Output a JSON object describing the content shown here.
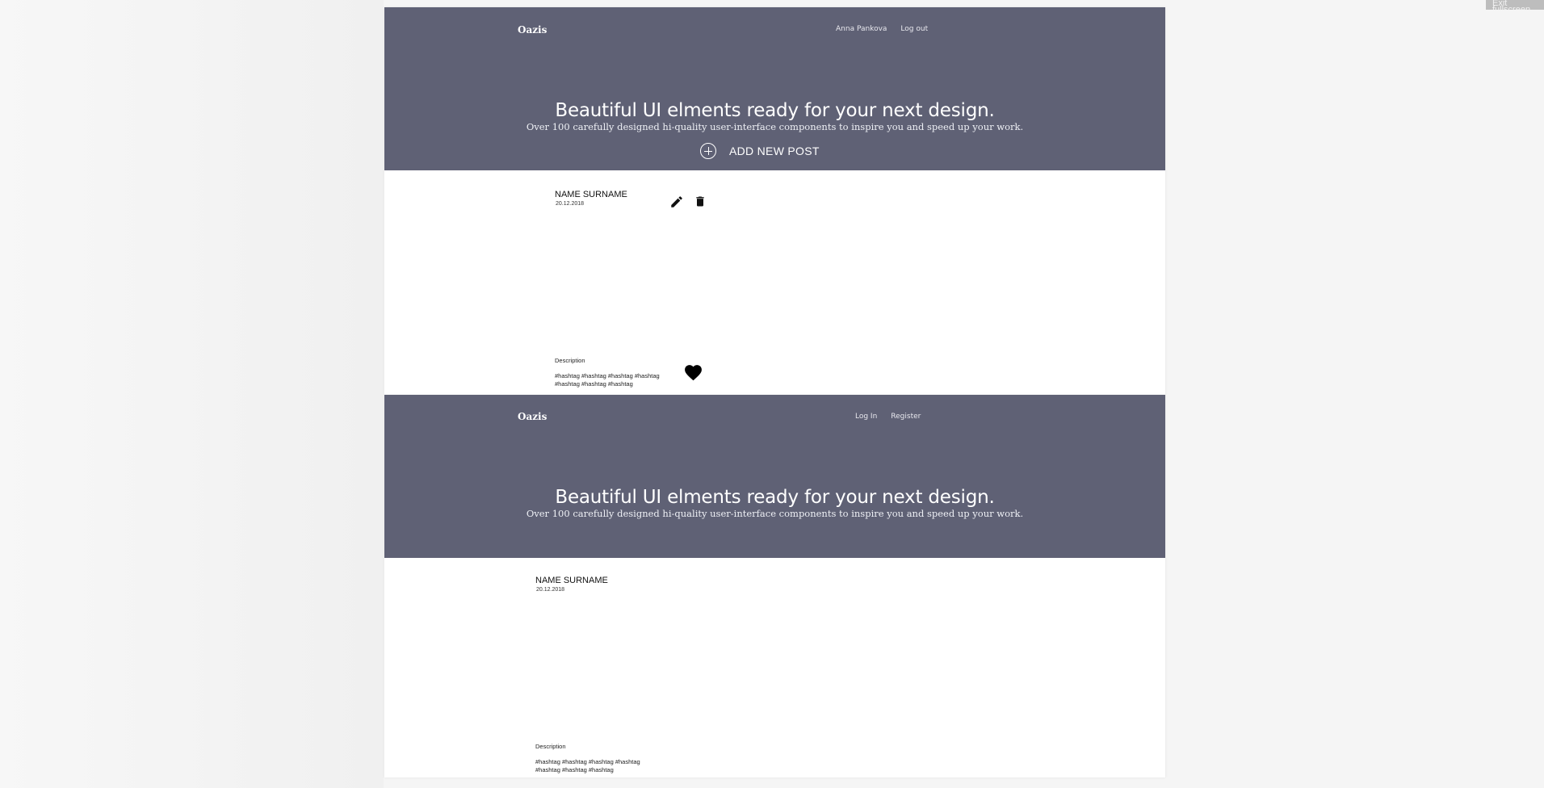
{
  "overlay": {
    "exit_fullscreen": "Exit fullscreen"
  },
  "screens": [
    {
      "brand": "Oazis",
      "nav": [
        "Anna Pankova",
        "Log out"
      ],
      "hero": {
        "title": "Beautiful UI elments ready for your next design.",
        "subtitle": "Over 100 carefully designed hi-quality user-interface components to inspire you and speed up your work."
      },
      "add_post_label": "ADD NEW POST",
      "post": {
        "name": "NAME SURNAME",
        "date": "20.12.2018",
        "description": "Description",
        "hashtags": "#hashtag #hashtag #hashtag #hashtag #hashtag #hashtag #hashtag",
        "icons": [
          "pencil-icon",
          "trash-icon",
          "heart-icon"
        ]
      }
    },
    {
      "brand": "Oazis",
      "nav": [
        "Log In",
        "Register"
      ],
      "hero": {
        "title": "Beautiful UI elments ready for your next design.",
        "subtitle": "Over 100 carefully designed hi-quality user-interface components to inspire you and speed up your work."
      },
      "post": {
        "name": "NAME SURNAME",
        "date": "20.12.2018",
        "description": "Description",
        "hashtags": "#hashtag #hashtag #hashtag #hashtag #hashtag #hashtag #hashtag"
      }
    }
  ],
  "colors": {
    "hero_bg": "#5f6175",
    "page_bg": "#f5f5f5",
    "content_bg": "#ffffff"
  }
}
